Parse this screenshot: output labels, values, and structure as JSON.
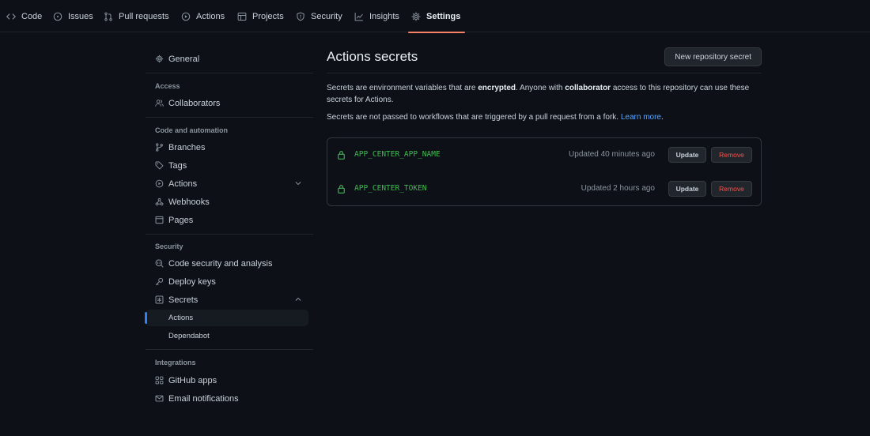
{
  "topnav": {
    "tabs": [
      {
        "label": "Code",
        "icon": "code-icon"
      },
      {
        "label": "Issues",
        "icon": "issue-opened-icon"
      },
      {
        "label": "Pull requests",
        "icon": "git-pull-request-icon"
      },
      {
        "label": "Actions",
        "icon": "play-icon"
      },
      {
        "label": "Projects",
        "icon": "table-icon"
      },
      {
        "label": "Security",
        "icon": "shield-icon"
      },
      {
        "label": "Insights",
        "icon": "graph-icon"
      },
      {
        "label": "Settings",
        "icon": "gear-icon",
        "active": true
      }
    ]
  },
  "sidebar": {
    "general": "General",
    "sections": {
      "access": "Access",
      "code_automation": "Code and automation",
      "security": "Security",
      "integrations": "Integrations"
    },
    "items": {
      "collaborators": "Collaborators",
      "branches": "Branches",
      "tags": "Tags",
      "actions": "Actions",
      "webhooks": "Webhooks",
      "pages": "Pages",
      "code_security": "Code security and analysis",
      "deploy_keys": "Deploy keys",
      "secrets": "Secrets",
      "secrets_actions": "Actions",
      "secrets_dependabot": "Dependabot",
      "github_apps": "GitHub apps",
      "email_notifications": "Email notifications"
    }
  },
  "main": {
    "title": "Actions secrets",
    "new_button": "New repository secret",
    "desc1": {
      "a": "Secrets are environment variables that are ",
      "b": "encrypted",
      "c": ". Anyone with ",
      "d": "collaborator",
      "e": " access to this repository can use these secrets for Actions."
    },
    "desc2": {
      "a": "Secrets are not passed to workflows that are triggered by a pull request from a fork. ",
      "link": "Learn more",
      "b": "."
    },
    "secrets": [
      {
        "name": "APP_CENTER_APP_NAME",
        "updated": "Updated 40 minutes ago",
        "update_label": "Update",
        "remove_label": "Remove"
      },
      {
        "name": "APP_CENTER_TOKEN",
        "updated": "Updated 2 hours ago",
        "update_label": "Update",
        "remove_label": "Remove"
      }
    ]
  },
  "colors": {
    "accent_underline": "#f78166",
    "link": "#58a6ff",
    "secret_green": "#3fb950",
    "danger": "#f85149",
    "selected_bar": "#2f81f7"
  }
}
